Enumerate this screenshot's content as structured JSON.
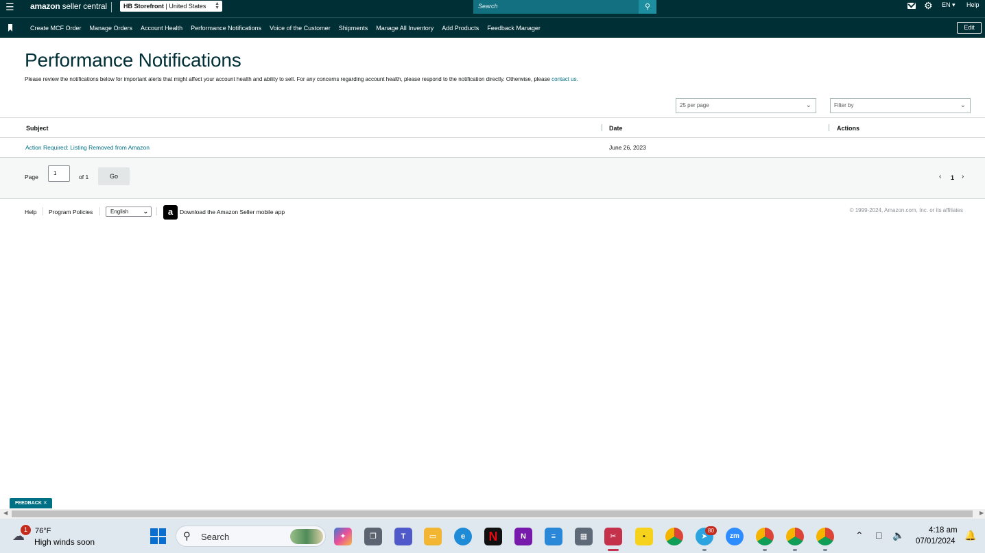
{
  "topbar": {
    "logo_brand": "amazon",
    "logo_product": "seller central",
    "store_name": "HB Storefront",
    "store_region": "United States",
    "search_placeholder": "Search",
    "language": "EN",
    "help": "Help"
  },
  "nav": {
    "items": [
      "Create MCF Order",
      "Manage Orders",
      "Account Health",
      "Performance Notifications",
      "Voice of the Customer",
      "Shipments",
      "Manage All Inventory",
      "Add Products",
      "Feedback Manager"
    ],
    "edit": "Edit"
  },
  "main": {
    "title": "Performance Notifications",
    "intro_text": "Please review the notifications below for important alerts that might affect your account health and ability to sell. For any concerns regarding account health, please respond to the notification directly. Otherwise, please",
    "intro_link": "contact us.",
    "per_page": "25 per page",
    "filter_placeholder": "Filter by"
  },
  "table": {
    "headers": {
      "subject": "Subject",
      "date": "Date",
      "actions": "Actions"
    },
    "rows": [
      {
        "subject": "Action Required: Listing Removed from Amazon",
        "date": "June 26, 2023"
      }
    ]
  },
  "pager": {
    "page_label": "Page",
    "current_page": "1",
    "of_label": "of 1",
    "go": "Go",
    "nav_current": "1"
  },
  "footer": {
    "help": "Help",
    "policies": "Program Policies",
    "language": "English",
    "app_text": "Download the Amazon Seller mobile app",
    "copyright": "© 1999-2024, Amazon.com, Inc. or its affiliates"
  },
  "feedback_label": "FEEDBACK",
  "taskbar": {
    "weather_badge": "1",
    "temperature": "76°F",
    "weather_desc": "High winds soon",
    "search_text": "Search",
    "telegram_badge": "80",
    "time": "4:18 am",
    "date": "07/01/2024"
  },
  "colors": {
    "header_bg": "#002f36",
    "search_bg": "#137081",
    "link": "#007185"
  }
}
